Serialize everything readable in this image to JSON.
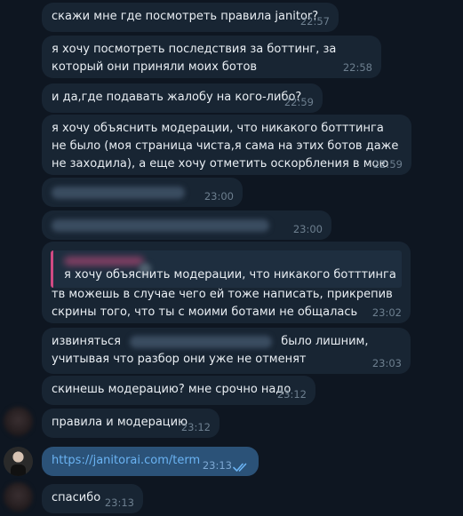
{
  "messages": [
    {
      "text": "скажи мне где посмотреть правила janitor?",
      "time": "22:57"
    },
    {
      "text": "я хочу посмотреть последствия за боттинг, за который они приняли моих ботов",
      "time": "22:58"
    },
    {
      "text": "и да,где подавать жалобу на кого-либо?",
      "time": "22:59"
    },
    {
      "text": "я хочу объяснить модерации, что никакого ботттинга не было (моя страница чиста,я сама на этих ботов даже не заходила), а еще хочу отметить оскорбления в мою сторону",
      "time": "22:59"
    },
    {
      "text": "",
      "time": "23:00"
    },
    {
      "text": "",
      "time": "23:00"
    },
    {
      "reply_text": "я хочу объяснить модерации, что никакого ботттинга не б...",
      "text": "тв можешь в случае чего ей тоже написать, прикрепив скрины того, что ты с моими ботами не общалась",
      "time": "23:02"
    },
    {
      "text_before": "извиняться",
      "text_after": "было лишним, учитывая что разбор они уже не отменят",
      "time": "23:03"
    },
    {
      "text": "скинешь модерацию? мне срочно надо",
      "time": "23:12"
    },
    {
      "text": "правила и модерацию",
      "time": "23:12"
    },
    {
      "link": "https://janitorai.com/term",
      "time": "23:13",
      "status": "read"
    },
    {
      "text": "спасибо",
      "time": "23:13"
    }
  ],
  "colors": {
    "background": "#0e1621",
    "incoming_bubble": "#182533",
    "outgoing_bubble": "#2b5278",
    "link": "#6ab3f3",
    "read_check": "#6ab3f3"
  },
  "icons": {
    "read_status": "double-check-icon"
  }
}
